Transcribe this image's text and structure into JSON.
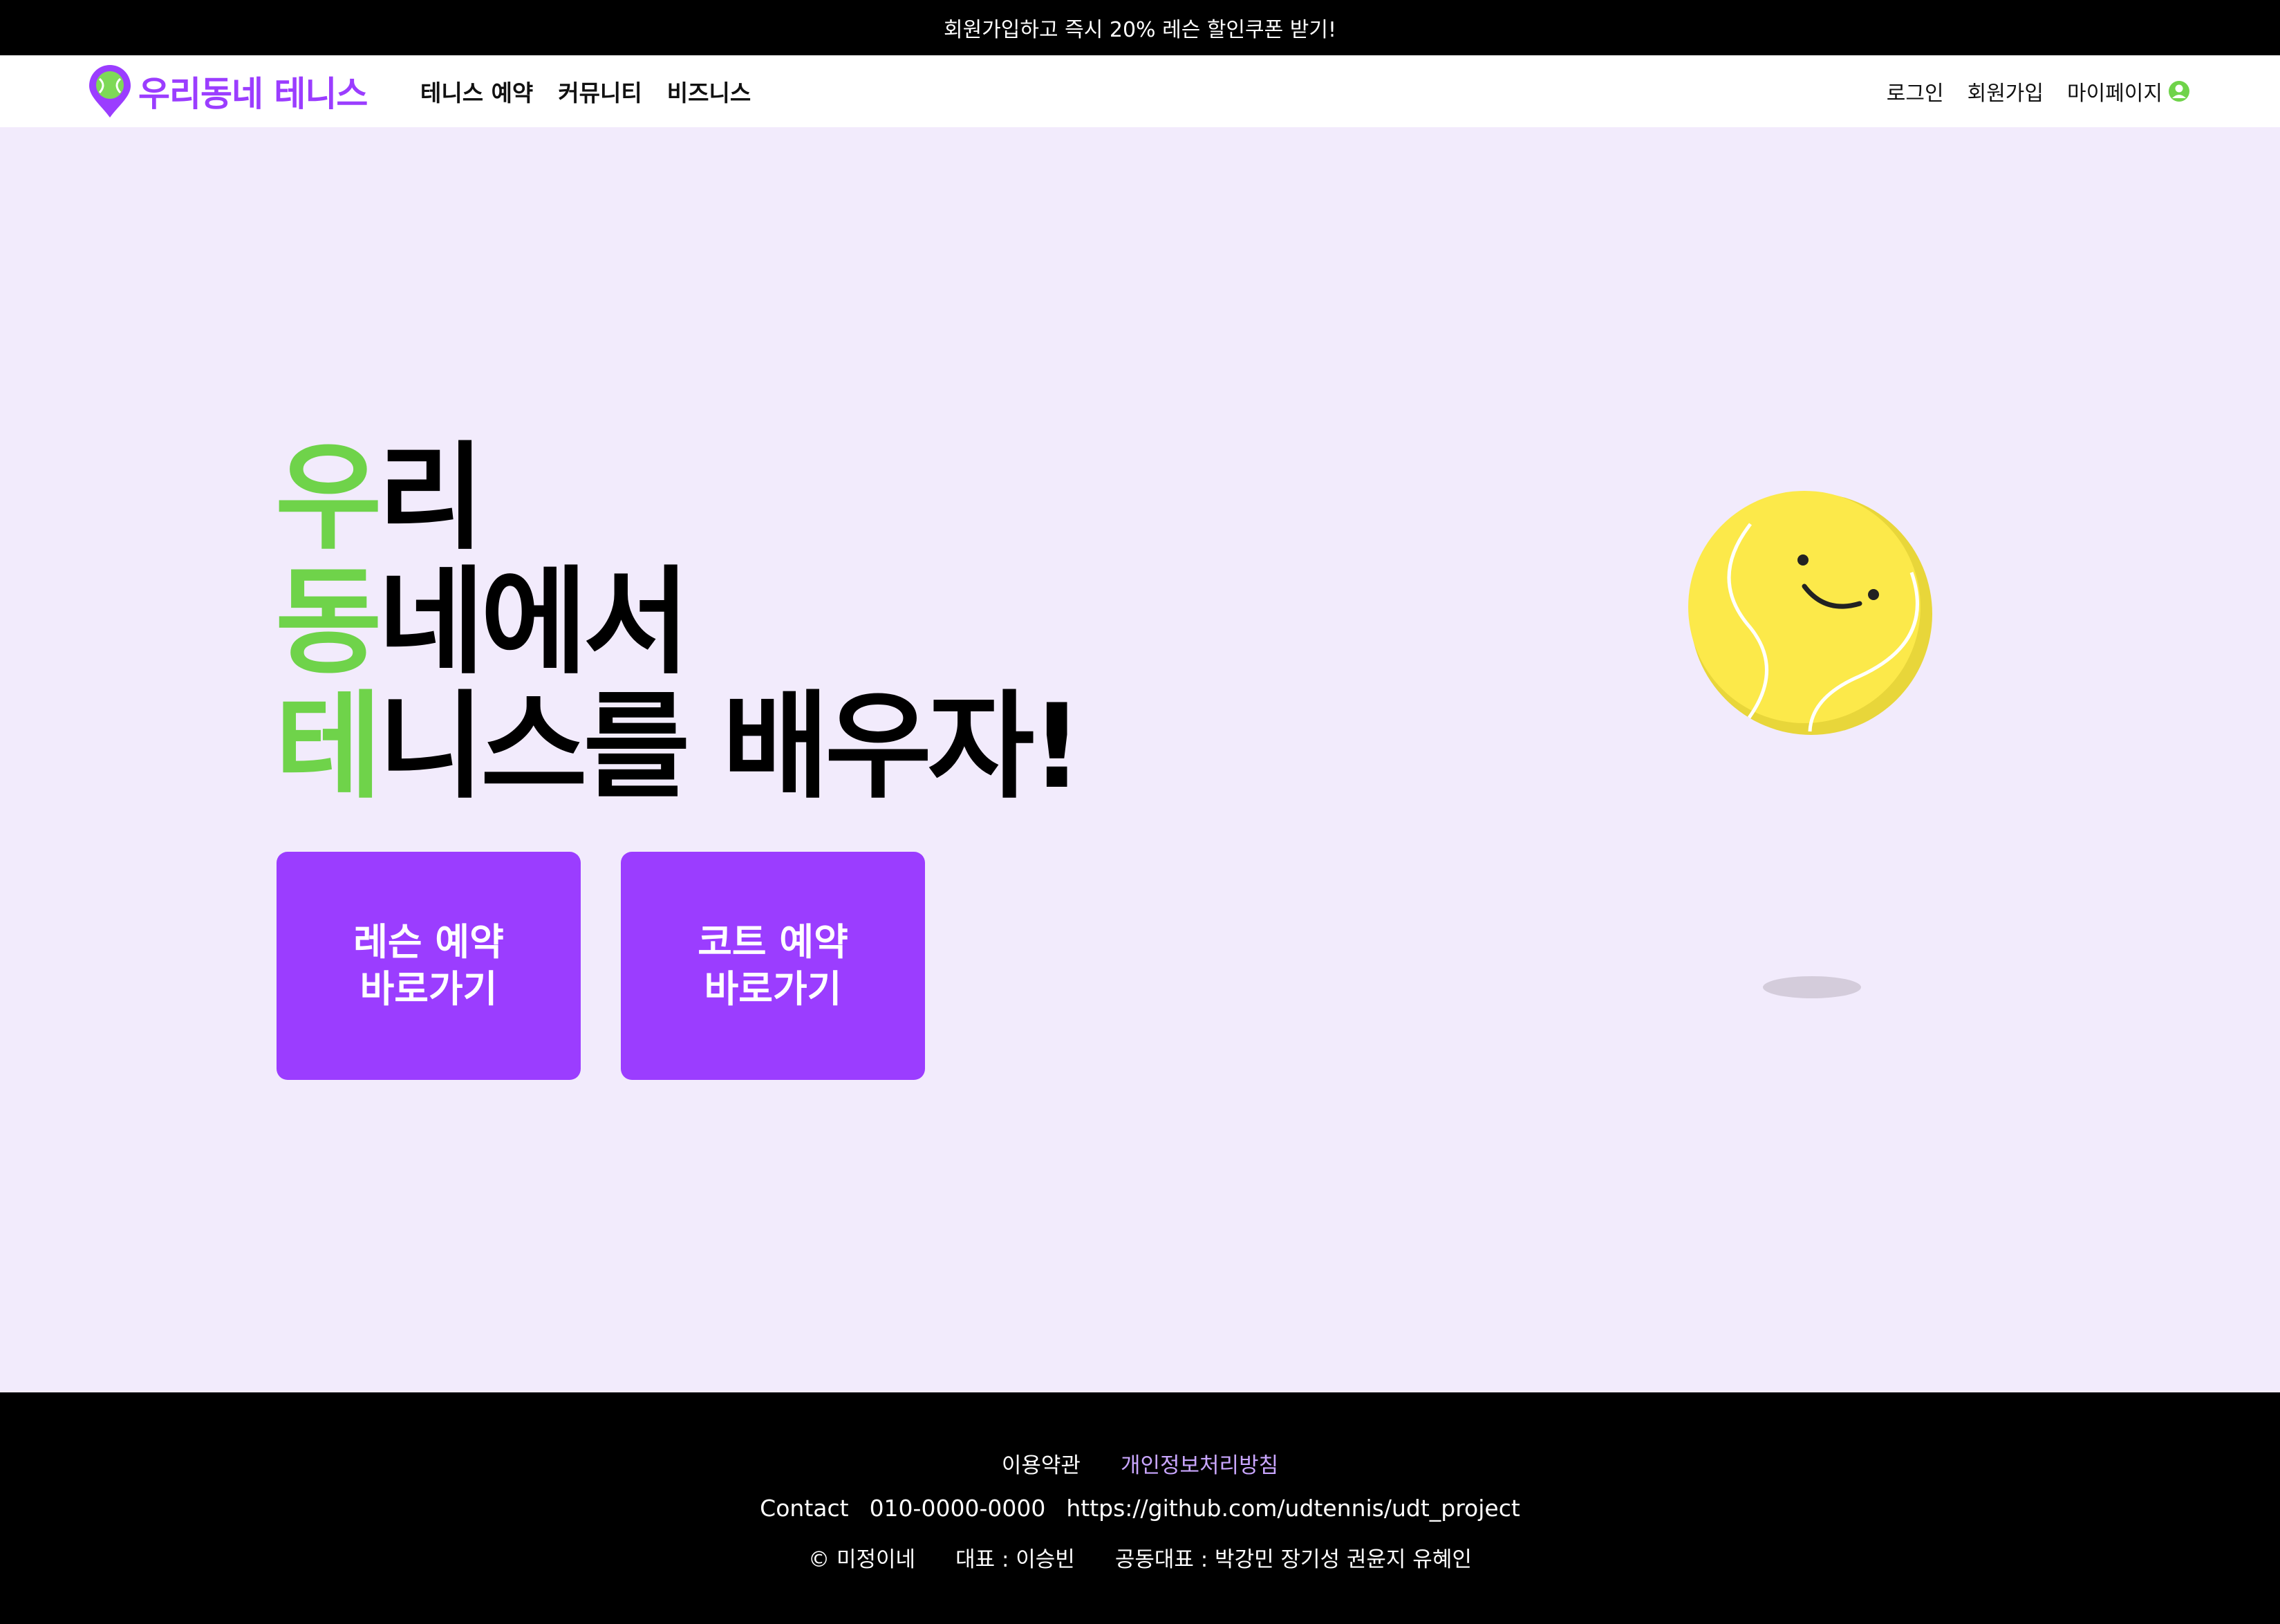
{
  "topbar": {
    "promo": "회원가입하고 즉시 20% 레슨 할인쿠폰 받기!"
  },
  "nav": {
    "logo": "우리동네 테니스",
    "links": [
      "테니스 예약",
      "커뮤니티",
      "비즈니스"
    ],
    "login": "로그인",
    "signup": "회원가입",
    "mypage": "마이페이지"
  },
  "hero": {
    "line1_accent": "우",
    "line1_rest": "리",
    "line2_accent": "동",
    "line2_rest": "네에서",
    "line3_accent": "테",
    "line3_rest": "니스를 배우자!",
    "lesson_button": "레슨 예약\n바로가기",
    "court_button": "코트 예약\n바로가기"
  },
  "footer": {
    "terms": "이용약관",
    "privacy": "개인정보처리방침",
    "contact_label": "Contact",
    "phone": "010-0000-0000",
    "github": "https://github.com/udtennis/udt_project",
    "copyright": "© 미정이네",
    "ceo": "대표 : 이승빈",
    "co_ceo": "공동대표 : 박강민 장기성 권윤지 유혜인"
  },
  "colors": {
    "brand_purple": "#9b3dff",
    "accent_green": "#6fd34a",
    "hero_bg": "#f2ebfc",
    "ball_yellow": "#fce94a"
  },
  "icons": [
    "tennis-location-pin-icon",
    "user-circle-icon",
    "smiling-tennis-ball-illustration"
  ]
}
